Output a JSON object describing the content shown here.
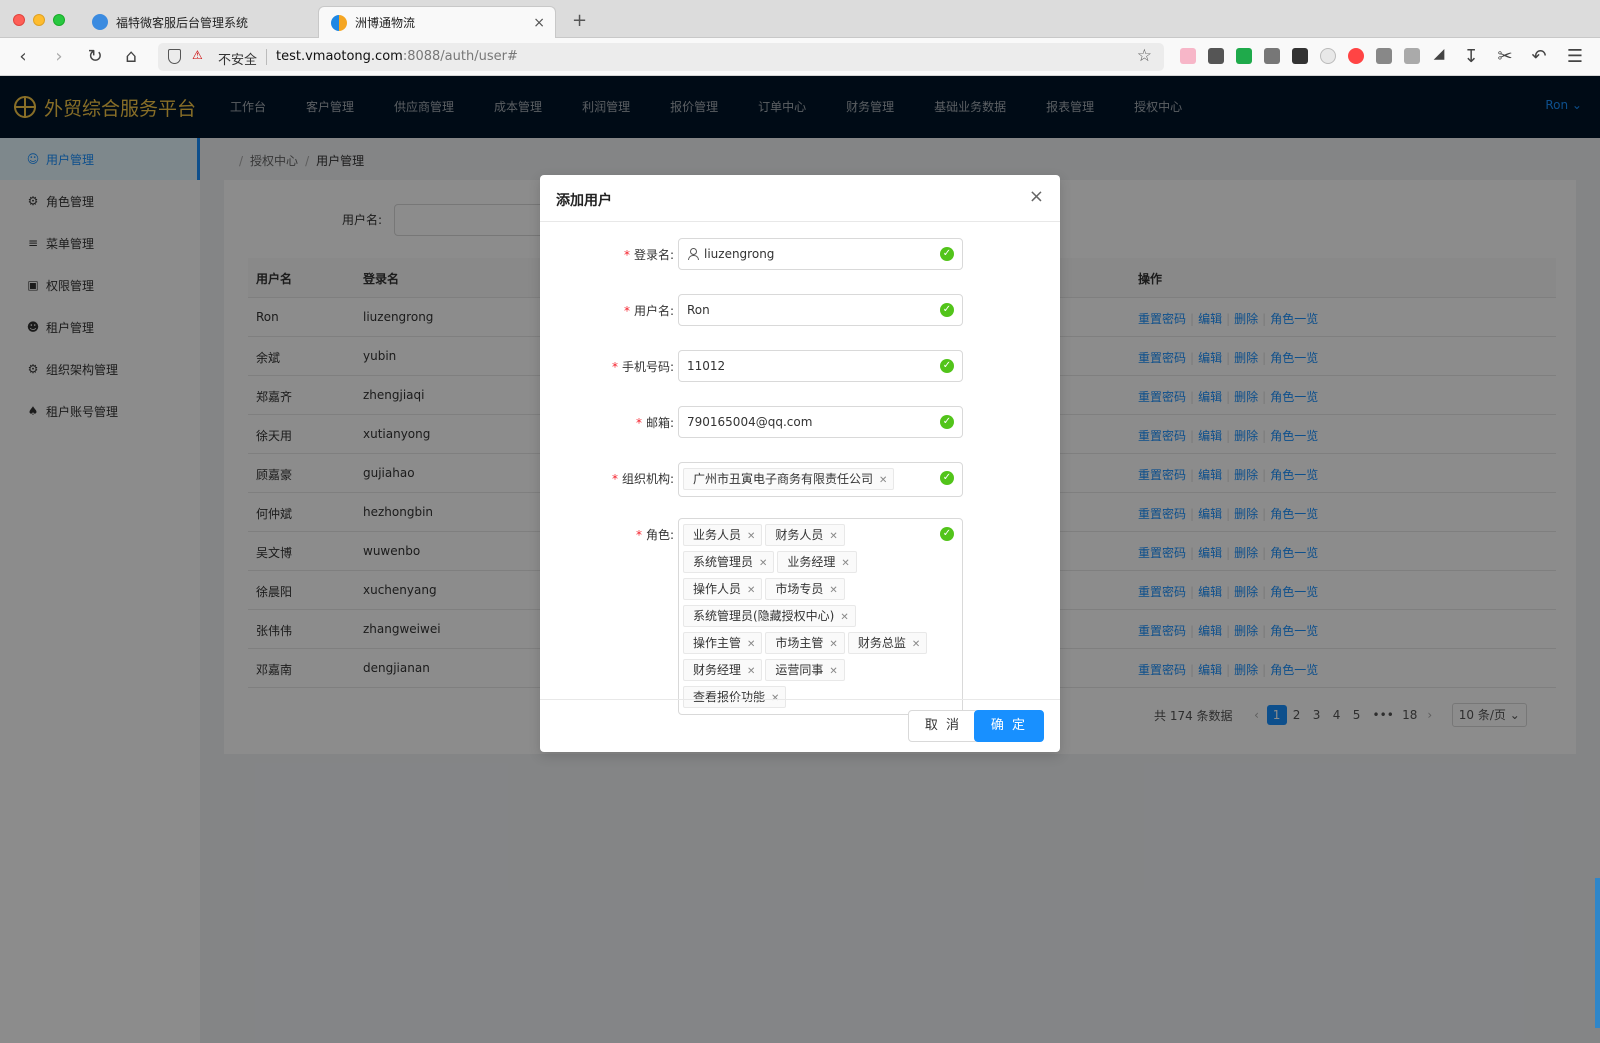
{
  "browser": {
    "tabs": [
      {
        "title": "福特微客服后台管理系统"
      },
      {
        "title": "洲博通物流"
      }
    ],
    "new_tab": "+",
    "close_glyph": "×",
    "url_security": "不安全",
    "url_host": "test.vmaotong.com",
    "url_rest": ":8088/auth/user#",
    "icons": [
      "back-icon",
      "forward-icon",
      "reload-icon",
      "home-icon",
      "shield-icon",
      "star-icon",
      "download-icon",
      "menu-icon"
    ]
  },
  "app": {
    "brand": "外贸综合服务平台",
    "nav": [
      "工作台",
      "客户管理",
      "供应商管理",
      "成本管理",
      "利润管理",
      "报价管理",
      "订单中心",
      "财务管理",
      "基础业务数据",
      "报表管理",
      "授权中心"
    ],
    "user": "Ron ⌄",
    "sidebar": [
      {
        "label": "用户管理",
        "icon": "user-icon"
      },
      {
        "label": "角色管理",
        "icon": "role-icon"
      },
      {
        "label": "菜单管理",
        "icon": "menu-icon"
      },
      {
        "label": "权限管理",
        "icon": "lock-icon"
      },
      {
        "label": "租户管理",
        "icon": "tenant-icon"
      },
      {
        "label": "组织架构管理",
        "icon": "org-icon"
      },
      {
        "label": "租户账号管理",
        "icon": "account-icon"
      }
    ],
    "breadcrumb": [
      "授权中心",
      "用户管理"
    ],
    "search_label": "用户名:",
    "table": {
      "headers": [
        "用户名",
        "登录名",
        "操作"
      ],
      "rows": [
        [
          "Ron",
          "liuzengrong"
        ],
        [
          "余斌",
          "yubin"
        ],
        [
          "郑嘉齐",
          "zhengjiaqi"
        ],
        [
          "徐天用",
          "xutianyong"
        ],
        [
          "顾嘉豪",
          "gujiahao"
        ],
        [
          "何仲斌",
          "hezhongbin"
        ],
        [
          "吴文博",
          "wuwenbo"
        ],
        [
          "徐晨阳",
          "xuchenyang"
        ],
        [
          "张伟伟",
          "zhangweiwei"
        ],
        [
          "邓嘉南",
          "dengjianan"
        ]
      ],
      "actions": [
        "重置密码",
        "编辑",
        "删除",
        "角色一览"
      ]
    },
    "pagination": {
      "total": "共 174 条数据",
      "prev": "‹",
      "pages": [
        "1",
        "2",
        "3",
        "4",
        "5",
        "•••",
        "18"
      ],
      "next": "›",
      "page_size": "10 条/页 ⌄",
      "current": "1"
    }
  },
  "modal": {
    "title": "添加用户",
    "close": "×",
    "fields": [
      {
        "label": "登录名",
        "value": "liuzengrong"
      },
      {
        "label": "用户名",
        "value": "Ron"
      },
      {
        "label": "手机号码",
        "value": "11012"
      },
      {
        "label": "邮箱",
        "value": "790165004@qq.com"
      }
    ],
    "org_label": "组织机构",
    "org_tags": [
      "广州市丑寅电子商务有限责任公司"
    ],
    "roles_label": "角色",
    "role_tags": [
      "业务人员",
      "财务人员",
      "系统管理员",
      "业务经理",
      "操作人员",
      "市场专员",
      "系统管理员(隐藏授权中心)",
      "操作主管",
      "市场主管",
      "财务总监",
      "财务经理",
      "运营同事",
      "查看报价功能"
    ],
    "label_suffix": ":",
    "required_mark": "*",
    "check_glyph": "✓",
    "tag_close": "✕",
    "cancel": "取 消",
    "ok": "确 定"
  },
  "colors": {
    "primary": "#1890ff",
    "nav_bg": "#001529",
    "brand": "#f7c948",
    "success": "#52c41a",
    "required": "#f5222d"
  }
}
